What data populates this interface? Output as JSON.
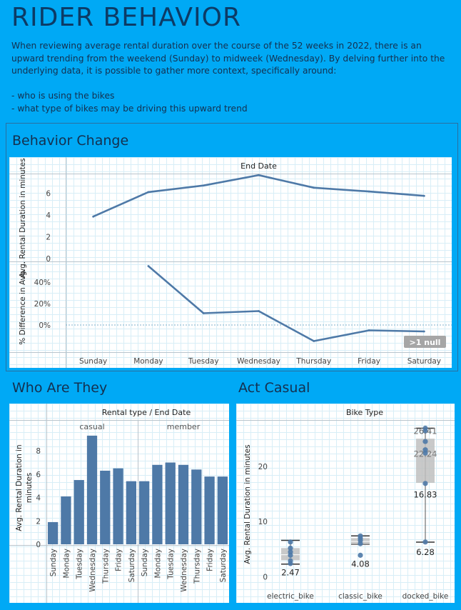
{
  "page": {
    "title": "RIDER BEHAVIOR",
    "intro_lines": [
      "When reviewing average rental duration over the course of the 52 weeks in 2022, there is an upward trending from the weekend (Sunday) to midweek (Wednesday). By delving further into the underlying data, it is possible to gather more context, specifically around:",
      "- who is using the bikes",
      "- what type of bikes may be driving this upward trend"
    ]
  },
  "sections": {
    "behavior_change": "Behavior Change",
    "who_are_they": "Who Are They",
    "act_casual": "Act Casual"
  },
  "colors": {
    "background": "#00a9f5",
    "series": "#4e79a7",
    "box_fill": "#bfbfbf",
    "null_badge": "#a6a6a6"
  },
  "chart_data": [
    {
      "id": "behavior-change",
      "type": "line",
      "header": "End Date",
      "categories": [
        "Sunday",
        "Monday",
        "Tuesday",
        "Wednesday",
        "Thursday",
        "Friday",
        "Saturday"
      ],
      "panes": [
        {
          "ylabel": "Avg. Rental Duration in minutes",
          "yticks": [
            0,
            2,
            4,
            6
          ],
          "ylim": [
            0,
            7.6
          ],
          "values": [
            3.85,
            6.1,
            6.7,
            7.65,
            6.5,
            6.15,
            5.75
          ]
        },
        {
          "ylabel": "% Difference in Avg. ..",
          "yticks": [
            0,
            20,
            40
          ],
          "tick_suffix": "%",
          "ylim": [
            -16,
            58
          ],
          "values": [
            null,
            55,
            11,
            13,
            -15,
            -5,
            -6
          ]
        }
      ],
      "null_indicator": ">1 null",
      "grid": true
    },
    {
      "id": "who-are-they",
      "type": "bar",
      "header": "Rental type  /  End Date",
      "groups": [
        "casual",
        "member"
      ],
      "categories": [
        "Sunday",
        "Monday",
        "Tuesday",
        "Wednesday",
        "Thursday",
        "Friday",
        "Saturday"
      ],
      "series": [
        {
          "values": [
            1.9,
            4.1,
            5.5,
            9.3,
            6.3,
            6.5,
            5.4
          ]
        },
        {
          "values": [
            5.4,
            6.8,
            7.0,
            6.8,
            6.4,
            5.8,
            5.8
          ]
        }
      ],
      "ylabel": "Avg. Rental Duration in minutes",
      "yticks": [
        0,
        2,
        4,
        6,
        8
      ],
      "ylim": [
        0,
        9.6
      ],
      "grid": true
    },
    {
      "id": "act-casual",
      "type": "box",
      "header": "Bike Type",
      "categories": [
        "electric_bike",
        "classic_bike",
        "docked_bike"
      ],
      "ylabel": "Avg. Rental Duration in minutes",
      "yticks": [
        0,
        10,
        20
      ],
      "ylim": [
        -2,
        28
      ],
      "boxes": [
        {
          "q1": 3.0,
          "q3": 5.2,
          "median": 4.0,
          "min": 2.3,
          "max": 6.6,
          "points": [
            2.4,
            2.9,
            3.9,
            4.5,
            5.2,
            6.3
          ],
          "labels": [
            2.47
          ]
        },
        {
          "q1": 5.9,
          "q3": 7.0,
          "median": 6.4,
          "min": 5.9,
          "max": 7.4,
          "points": [
            3.9,
            6.0,
            6.6,
            7.0,
            7.4
          ],
          "labels": [
            4.08
          ]
        },
        {
          "q1": 17.0,
          "q3": 25.0,
          "median": 22.24,
          "min": 6.28,
          "max": 26.9,
          "points": [
            6.3,
            16.9,
            22.4,
            23.0,
            24.5,
            26.4,
            26.9
          ],
          "labels": [
            26.41,
            22.24,
            16.83,
            6.28
          ]
        }
      ],
      "grid": true
    }
  ]
}
